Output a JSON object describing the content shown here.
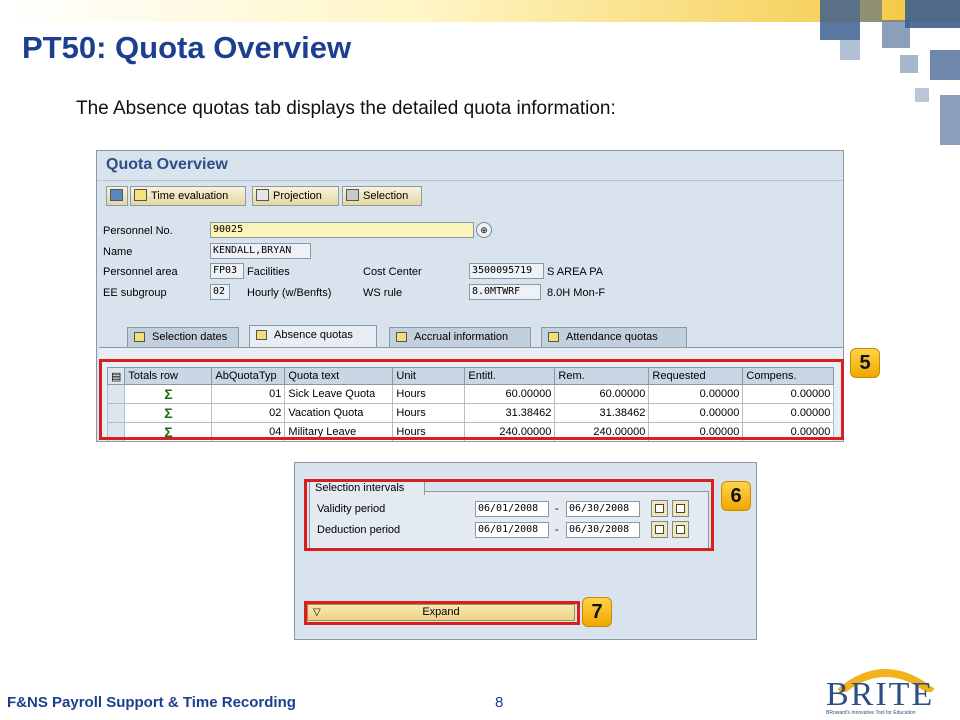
{
  "slide": {
    "title": "PT50: Quota Overview",
    "subtitle": "The Absence quotas tab displays the detailed quota information:",
    "footer": "F&NS Payroll Support & Time Recording",
    "page_number": "8",
    "logo": "BRITE",
    "logo_tagline": "BRoward's Innovative Tool for Education"
  },
  "sap_screen": {
    "title": "Quota Overview",
    "toolbar": [
      {
        "label": "",
        "icon": "refresh-icon"
      },
      {
        "label": "Time evaluation",
        "icon": "clock-icon"
      },
      {
        "label": "Projection",
        "icon": "calculator-icon"
      },
      {
        "label": "Selection",
        "icon": "binoculars-icon"
      }
    ],
    "fields": {
      "personnel_no_label": "Personnel No.",
      "personnel_no": "90025",
      "name_label": "Name",
      "name": "KENDALL,BRYAN",
      "personnel_area_label": "Personnel area",
      "personnel_area_code": "FP03",
      "personnel_area_text": "Facilities",
      "cost_center_label": "Cost Center",
      "cost_center": "3500095719",
      "cost_center_text": "S AREA PA",
      "ee_subgroup_label": "EE subgroup",
      "ee_subgroup_code": "02",
      "ee_subgroup_text": "Hourly  (w/Benfts)",
      "ws_rule_label": "WS rule",
      "ws_rule": "8.0MTWRF",
      "ws_rule_text": "8.0H Mon-F"
    },
    "tabs": [
      {
        "label": "Selection dates",
        "icon": "calendar-icon"
      },
      {
        "label": "Absence quotas",
        "icon": "edit-icon",
        "active": true
      },
      {
        "label": "Accrual information",
        "icon": "arrow-icon"
      },
      {
        "label": "Attendance quotas",
        "icon": "arrow-icon"
      }
    ],
    "grid": {
      "columns": [
        "Totals row",
        "AbQuotaTyp",
        "Quota text",
        "Unit",
        "Entitl.",
        "Rem.",
        "Requested",
        "Compens."
      ],
      "rows": [
        {
          "totals": "Σ",
          "type": "01",
          "text": "Sick Leave Quota",
          "unit": "Hours",
          "entitl": "60.00000",
          "rem": "60.00000",
          "requested": "0.00000",
          "compens": "0.00000"
        },
        {
          "totals": "Σ",
          "type": "02",
          "text": "Vacation Quota",
          "unit": "Hours",
          "entitl": "31.38462",
          "rem": "31.38462",
          "requested": "0.00000",
          "compens": "0.00000"
        },
        {
          "totals": "Σ",
          "type": "04",
          "text": "Military Leave",
          "unit": "Hours",
          "entitl": "240.00000",
          "rem": "240.00000",
          "requested": "0.00000",
          "compens": "0.00000"
        }
      ]
    }
  },
  "selection_screen": {
    "group_title": "Selection intervals",
    "validity_label": "Validity period",
    "validity_from": "06/01/2008",
    "validity_to": "06/30/2008",
    "deduction_label": "Deduction period",
    "deduction_from": "06/01/2008",
    "deduction_to": "06/30/2008",
    "dash": "-",
    "expand_label": "Expand"
  },
  "markers": [
    "5",
    "6",
    "7"
  ],
  "colors": {
    "title": "#1d3f8f",
    "highlight": "#d91e1e",
    "marker": "#f5b800",
    "sap_bg": "#d9e3ee"
  }
}
